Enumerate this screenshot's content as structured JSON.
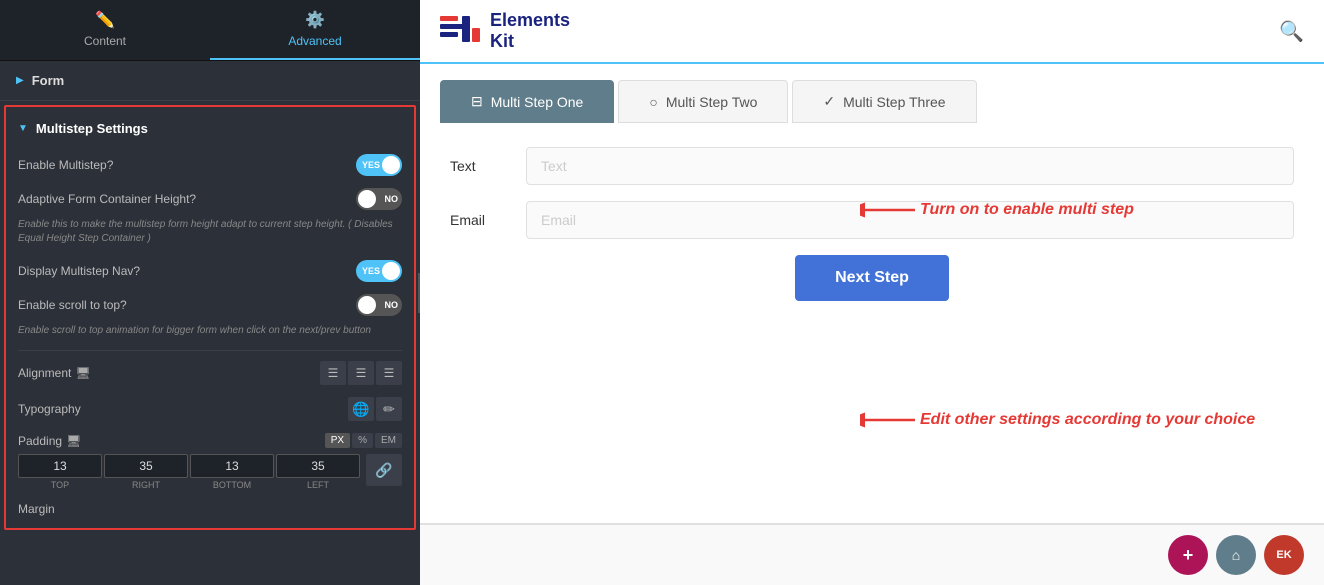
{
  "leftPanel": {
    "tabs": [
      {
        "id": "content",
        "label": "Content",
        "icon": "✏️",
        "active": false
      },
      {
        "id": "advanced",
        "label": "Advanced",
        "icon": "⚙️",
        "active": true
      }
    ],
    "formSection": {
      "label": "Form"
    },
    "multistepSettings": {
      "title": "Multistep Settings",
      "rows": [
        {
          "id": "enable-multistep",
          "label": "Enable Multistep?",
          "toggleState": "on",
          "toggleText": "YES"
        },
        {
          "id": "adaptive-height",
          "label": "Adaptive Form Container Height?",
          "toggleState": "off",
          "toggleText": "NO",
          "hint": "Enable this to make the multistep form height adapt to current step height. ( Disables Equal Height Step Container )"
        },
        {
          "id": "display-nav",
          "label": "Display Multistep Nav?",
          "toggleState": "on",
          "toggleText": "YES"
        },
        {
          "id": "scroll-to-top",
          "label": "Enable scroll to top?",
          "toggleState": "off",
          "toggleText": "NO",
          "hint": "Enable scroll to top animation for bigger form when click on the next/prev button"
        }
      ],
      "alignment": {
        "label": "Alignment",
        "buttons": [
          "≡",
          "≡",
          "≡"
        ]
      },
      "typography": {
        "label": "Typography",
        "buttons": [
          "🌐",
          "✏"
        ]
      },
      "padding": {
        "label": "Padding",
        "units": [
          "PX",
          "%",
          "EM"
        ],
        "activeUnit": "PX",
        "values": [
          {
            "value": "13",
            "label": "TOP"
          },
          {
            "value": "35",
            "label": "RIGHT"
          },
          {
            "value": "13",
            "label": "BOTTOM"
          },
          {
            "value": "35",
            "label": "LEFT"
          }
        ]
      },
      "margin": {
        "label": "Margin"
      }
    }
  },
  "rightPanel": {
    "logo": {
      "text1": "Elements",
      "text2": "Kit"
    },
    "steps": [
      {
        "id": "step1",
        "label": "Multi Step One",
        "icon": "⊟",
        "active": true
      },
      {
        "id": "step2",
        "label": "Multi Step Two",
        "icon": "○",
        "active": false
      },
      {
        "id": "step3",
        "label": "Multi Step Three",
        "icon": "✓",
        "active": false
      }
    ],
    "formFields": [
      {
        "id": "text-field",
        "label": "Text",
        "placeholder": "Text"
      },
      {
        "id": "email-field",
        "label": "Email",
        "placeholder": "Email"
      }
    ],
    "nextButton": {
      "label": "Next Step"
    },
    "annotations": [
      {
        "id": "ann1",
        "text": "Turn on to enable multi step"
      },
      {
        "id": "ann2",
        "text": "Edit other settings according to your choice"
      }
    ],
    "fabButtons": [
      {
        "id": "fab-add",
        "icon": "+",
        "color": "#ad1457"
      },
      {
        "id": "fab-folder",
        "icon": "🏠",
        "color": "#607d8b"
      },
      {
        "id": "fab-ek",
        "icon": "EK",
        "color": "#c0392b"
      }
    ]
  }
}
